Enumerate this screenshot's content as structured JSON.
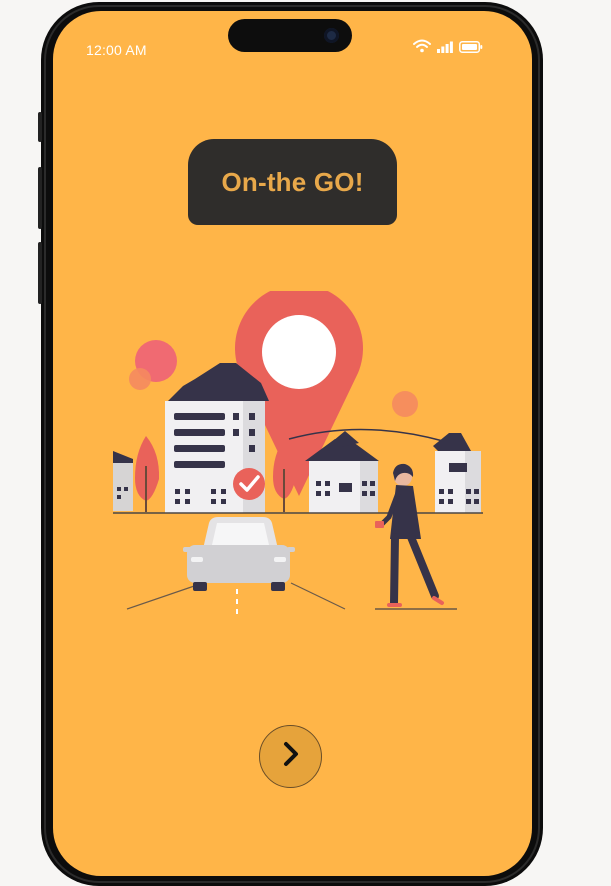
{
  "status_bar": {
    "time": "12:00 AM",
    "icons": [
      "wifi-icon",
      "signal-icon",
      "battery-icon"
    ]
  },
  "onboarding": {
    "title": "On-the GO!",
    "illustration": "city-location-pin-car-pedestrian",
    "next_icon": "chevron-right-icon"
  },
  "colors": {
    "screen_background": "#ffb548",
    "title_pill": "#2f2d2b",
    "title_text": "#e8a84a",
    "accent_red": "#e9625a",
    "building_dark": "#363349"
  }
}
